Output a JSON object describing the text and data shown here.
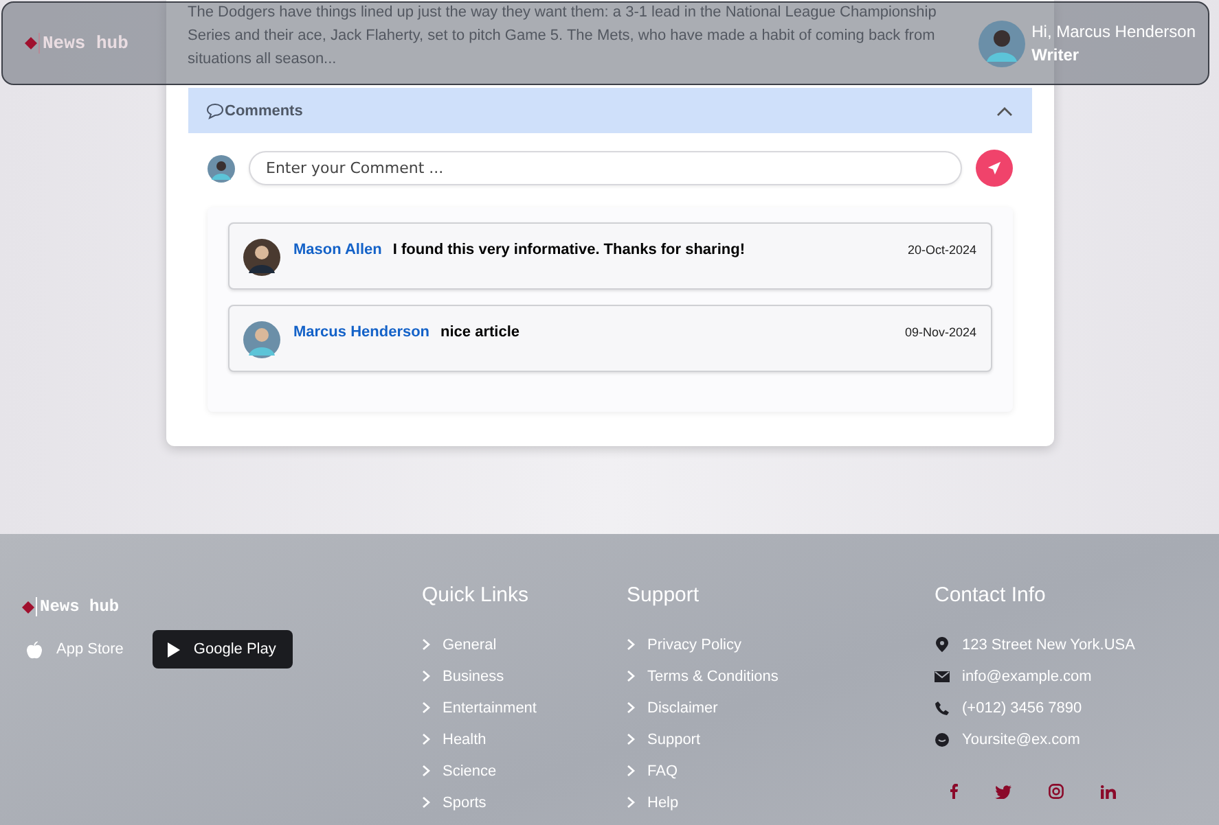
{
  "header": {
    "logo": "News hub",
    "greeting": "Hi, Marcus Henderson",
    "role": "Writer"
  },
  "article": {
    "lines": [
      "The Dodgers have things lined up just the way they want them: a 3-1 lead in the National League Championship",
      "Series and their ace, Jack Flaherty, set to pitch Game 5. The Mets, who have made a habit of coming back from",
      "situations all season..."
    ]
  },
  "comments": {
    "title": "Comments",
    "expanded": true,
    "placeholder": "Enter your Comment ...",
    "items": [
      {
        "author": "Mason Allen",
        "text": "I found this very informative. Thanks for sharing!",
        "date": "20-Oct-2024"
      },
      {
        "author": "Marcus Henderson",
        "text": "nice article",
        "date": "09-Nov-2024"
      }
    ]
  },
  "footer": {
    "logo": "News hub",
    "app_buttons": [
      {
        "label": "App Store",
        "kind": "plain"
      },
      {
        "label": "Google Play",
        "kind": "dark"
      }
    ],
    "quick_links": {
      "title": "Quick Links",
      "items": [
        "General",
        "Business",
        "Entertainment",
        "Health",
        "Science",
        "Sports"
      ]
    },
    "support": {
      "title": "Support",
      "items": [
        "Privacy Policy",
        "Terms & Conditions",
        "Disclaimer",
        "Support",
        "FAQ",
        "Help"
      ]
    },
    "contact": {
      "title": "Contact Info",
      "items": [
        {
          "kind": "address",
          "text": "123 Street New York.USA"
        },
        {
          "kind": "email",
          "text": "info@example.com"
        },
        {
          "kind": "phone",
          "text": "(+012) 3456 7890"
        },
        {
          "kind": "web",
          "text": "Yoursite@ex.com"
        }
      ]
    }
  }
}
